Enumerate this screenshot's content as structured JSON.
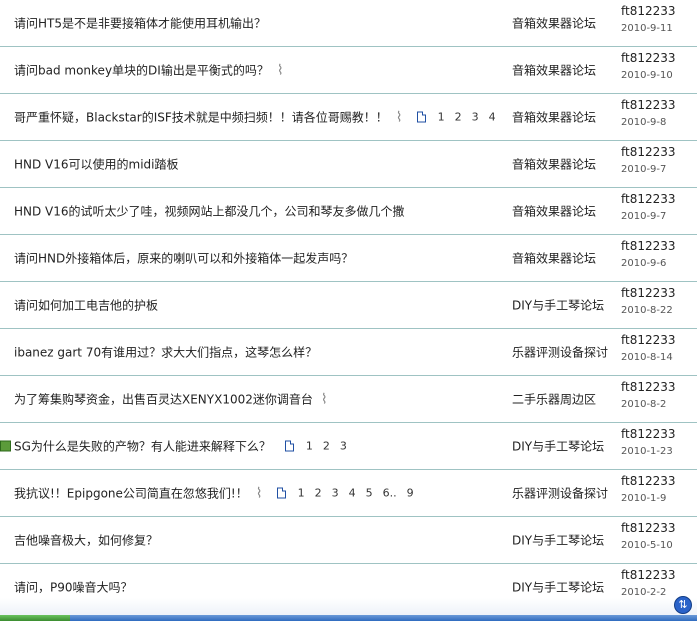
{
  "threads": [
    {
      "title": "请问HT5是不是非要接箱体才能使用耳机输出？",
      "forum": "音箱效果器论坛",
      "author": "ft812233",
      "date": "2010-9-11"
    },
    {
      "title": "请问bad monkey单块的DI输出是平衡式的吗？",
      "has_attachment": true,
      "forum": "音箱效果器论坛",
      "author": "ft812233",
      "date": "2010-9-10"
    },
    {
      "title": "哥严重怀疑，Blackstar的ISF技术就是中频扫频！！请各位哥赐教！！",
      "has_attachment": true,
      "pages": [
        "1",
        "2",
        "3",
        "4"
      ],
      "forum": "音箱效果器论坛",
      "author": "ft812233",
      "date": "2010-9-8"
    },
    {
      "title": "HND V16可以使用的midi踏板",
      "forum": "音箱效果器论坛",
      "author": "ft812233",
      "date": "2010-9-7"
    },
    {
      "title": "HND V16的试听太少了哇，视频网站上都没几个，公司和琴友多做几个撒",
      "forum": "音箱效果器论坛",
      "author": "ft812233",
      "date": "2010-9-7"
    },
    {
      "title": "请问HND外接箱体后，原来的喇叭可以和外接箱体一起发声吗？",
      "forum": "音箱效果器论坛",
      "author": "ft812233",
      "date": "2010-9-6"
    },
    {
      "title": "请问如何加工电吉他的护板",
      "forum": "DIY与手工琴论坛",
      "author": "ft812233",
      "date": "2010-8-22"
    },
    {
      "title": "ibanez gart 70有谁用过？求大大们指点，这琴怎么样？",
      "forum": "乐器评测设备探讨",
      "author": "ft812233",
      "date": "2010-8-14"
    },
    {
      "title": "为了筹集购琴资金，出售百灵达XENYX1002迷你调音台",
      "has_attachment": true,
      "forum": "二手乐器周边区",
      "author": "ft812233",
      "date": "2010-8-2"
    },
    {
      "title": "SG为什么是失败的产物？有人能进来解释下么？",
      "has_image": true,
      "pages": [
        "1",
        "2",
        "3"
      ],
      "forum": "DIY与手工琴论坛",
      "author": "ft812233",
      "date": "2010-1-23"
    },
    {
      "title": "我抗议!！Epipgone公司简直在忽悠我们!！",
      "has_attachment": true,
      "pages": [
        "1",
        "2",
        "3",
        "4",
        "5",
        "6..",
        "9"
      ],
      "forum": "乐器评测设备探讨",
      "author": "ft812233",
      "date": "2010-1-9"
    },
    {
      "title": "吉他噪音极大，如何修复？",
      "forum": "DIY与手工琴论坛",
      "author": "ft812233",
      "date": "2010-5-10"
    },
    {
      "title": "请问，P90噪音大吗？",
      "forum": "DIY与手工琴论坛",
      "author": "ft812233",
      "date": "2010-2-2"
    }
  ],
  "icons": {
    "attachment": "paperclip-icon",
    "pages": "page-icon",
    "image": "image-icon",
    "tray": "network-icon"
  },
  "colors": {
    "row_border": "#9fc3c3",
    "taskbar": "#2f6bbf"
  }
}
